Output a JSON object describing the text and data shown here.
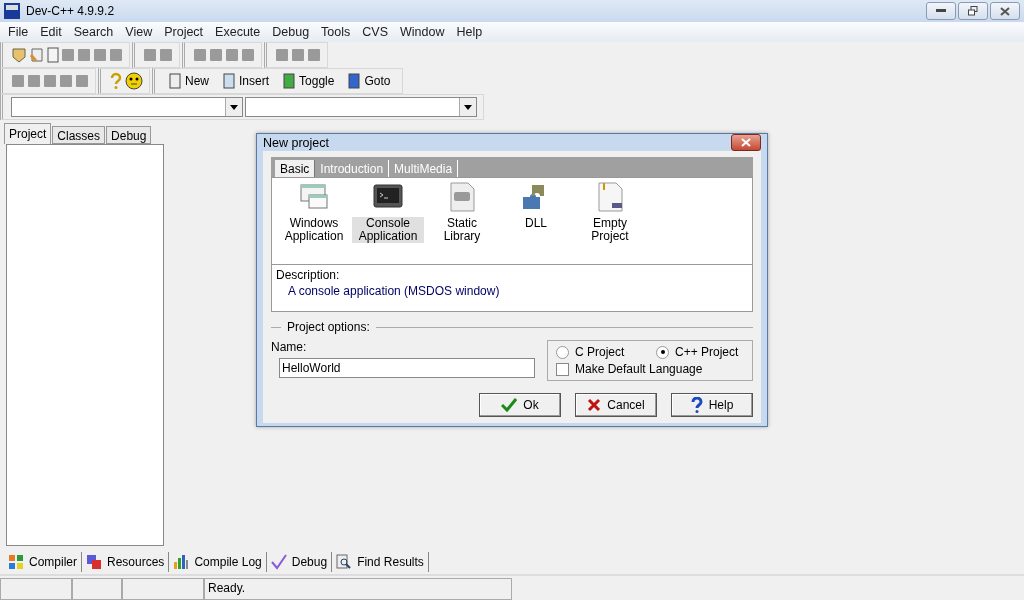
{
  "window": {
    "title": "Dev-C++ 4.9.9.2"
  },
  "menu": [
    "File",
    "Edit",
    "Search",
    "View",
    "Project",
    "Execute",
    "Debug",
    "Tools",
    "CVS",
    "Window",
    "Help"
  ],
  "toolbar_buttons": [
    "New",
    "Insert",
    "Toggle",
    "Goto"
  ],
  "side_tabs": [
    {
      "label": "Project",
      "selected": true
    },
    {
      "label": "Classes",
      "selected": false
    },
    {
      "label": "Debug",
      "selected": false
    }
  ],
  "dialog": {
    "title": "New project",
    "tabs": [
      {
        "label": "Basic",
        "selected": true
      },
      {
        "label": "Introduction",
        "selected": false
      },
      {
        "label": "MultiMedia",
        "selected": false
      }
    ],
    "templates": [
      {
        "label": "Windows Application",
        "kind": "windows",
        "selected": false
      },
      {
        "label": "Console Application",
        "kind": "console",
        "selected": true
      },
      {
        "label": "Static Library",
        "kind": "library",
        "selected": false
      },
      {
        "label": "DLL",
        "kind": "dll",
        "selected": false
      },
      {
        "label": "Empty Project",
        "kind": "empty",
        "selected": false
      }
    ],
    "description_label": "Description:",
    "description": "A console application (MSDOS window)",
    "options_legend": "Project options:",
    "name_label": "Name:",
    "name_value": "HelloWorld",
    "languages": [
      {
        "label": "C Project",
        "selected": false
      },
      {
        "label": "C++ Project",
        "selected": true
      }
    ],
    "default_language": {
      "label": "Make Default Language",
      "checked": false
    },
    "buttons": [
      {
        "label": "Ok",
        "kind": "ok"
      },
      {
        "label": "Cancel",
        "kind": "cancel"
      },
      {
        "label": "Help",
        "kind": "help"
      }
    ]
  },
  "bottom_tabs": [
    {
      "label": "Compiler",
      "kind": "compiler"
    },
    {
      "label": "Resources",
      "kind": "resources"
    },
    {
      "label": "Compile Log",
      "kind": "log"
    },
    {
      "label": "Debug",
      "kind": "debug"
    },
    {
      "label": "Find Results",
      "kind": "find"
    }
  ],
  "status": "Ready."
}
